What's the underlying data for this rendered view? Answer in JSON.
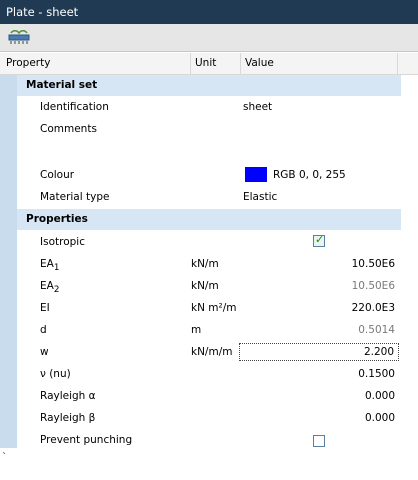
{
  "window": {
    "title": "Plate - sheet"
  },
  "toolbar": {
    "icon": "plate-material-icon"
  },
  "columns": {
    "property": "Property",
    "unit": "Unit",
    "value": "Value"
  },
  "material_set": {
    "label": "Material set",
    "identification": {
      "label": "Identification",
      "value": "sheet"
    },
    "comments": {
      "label": "Comments",
      "value": ""
    },
    "colour": {
      "label": "Colour",
      "value": "RGB 0, 0, 255",
      "color": "#0000ff"
    },
    "material_type": {
      "label": "Material type",
      "value": "Elastic"
    }
  },
  "properties": {
    "label": "Properties",
    "isotropic": {
      "label": "Isotropic",
      "checked": true
    },
    "ea1": {
      "label": "EA",
      "sub": "1",
      "unit": "kN/m",
      "value": "10.50E6"
    },
    "ea2": {
      "label": "EA",
      "sub": "2",
      "unit": "kN/m",
      "value": "10.50E6"
    },
    "ei": {
      "label": "EI",
      "unit": "kN m²/m",
      "value": "220.0E3"
    },
    "d": {
      "label": "d",
      "unit": "m",
      "value": "0.5014"
    },
    "w": {
      "label": "w",
      "unit": "kN/m/m",
      "value": "2.200"
    },
    "nu": {
      "label": "ν (nu)",
      "value": "0.1500"
    },
    "rayleigh_alpha": {
      "label": "Rayleigh α",
      "value": "0.000"
    },
    "rayleigh_beta": {
      "label": "Rayleigh β",
      "value": "0.000"
    },
    "prevent_punching": {
      "label": "Prevent punching",
      "checked": false
    }
  }
}
